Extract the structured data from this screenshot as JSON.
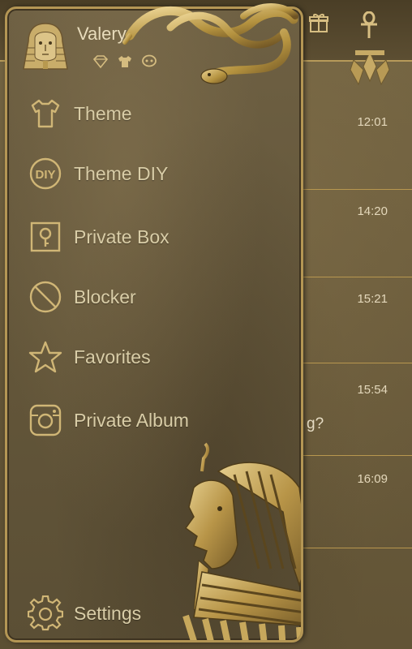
{
  "conversations": [
    {
      "time": "12:01",
      "snippet": ""
    },
    {
      "time": "14:20",
      "snippet": ""
    },
    {
      "time": "15:21",
      "snippet": ""
    },
    {
      "time": "15:54",
      "snippet": "g?"
    },
    {
      "time": "16:09",
      "snippet": ""
    }
  ],
  "drawer": {
    "username": "Valery",
    "header_icons": [
      "diamond-icon",
      "shirt-icon",
      "chat-bubble-icon"
    ],
    "menu": [
      {
        "label": "Theme",
        "icon": "shirt-icon"
      },
      {
        "label": "Theme DIY",
        "icon": "diy-icon",
        "icon_text": "DIY"
      },
      {
        "label": "Private Box",
        "icon": "private-box-icon"
      },
      {
        "label": "Blocker",
        "icon": "block-icon"
      },
      {
        "label": "Favorites",
        "icon": "star-icon"
      },
      {
        "label": "Private Album",
        "icon": "camera-icon"
      }
    ],
    "settings_label": "Settings"
  },
  "top_bar": {
    "icons": [
      "gift-icon",
      "ankh-icon"
    ]
  },
  "colors": {
    "gold": "#b49654",
    "text": "#d9cda7",
    "background": "#6b5c3c"
  }
}
